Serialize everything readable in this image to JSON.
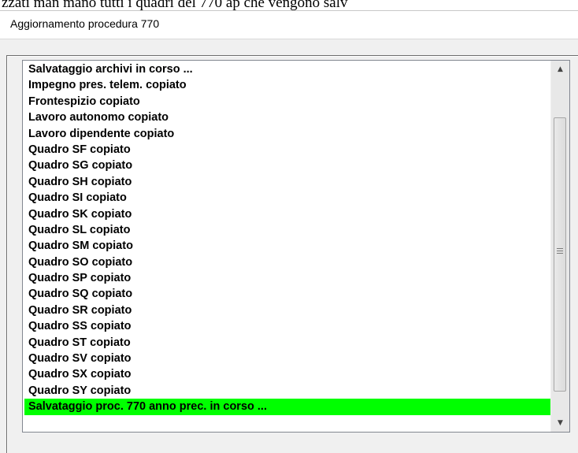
{
  "background_text": "zzati man mano tutti i quadri del 770 ap che vengono salv",
  "window": {
    "title": "Aggiornamento procedura 770"
  },
  "list": {
    "items": [
      "Salvataggio archivi in corso ...",
      "Impegno pres. telem. copiato",
      "Frontespizio copiato",
      "Lavoro autonomo copiato",
      "Lavoro dipendente copiato",
      "Quadro SF copiato",
      "Quadro SG copiato",
      "Quadro SH copiato",
      "Quadro SI copiato",
      "Quadro SK copiato",
      "Quadro SL copiato",
      "Quadro SM copiato",
      "Quadro SO copiato",
      "Quadro SP copiato",
      "Quadro SQ copiato",
      "Quadro SR copiato",
      "Quadro SS copiato",
      "Quadro ST copiato",
      "Quadro SV copiato",
      "Quadro SX copiato",
      "Quadro SY copiato",
      "Salvataggio proc. 770 anno prec. in corso ..."
    ],
    "selected_index": 21,
    "selected_color": "#00ff00"
  },
  "scrollbar": {
    "up_icon": "arrow-up-icon",
    "down_icon": "arrow-down-icon",
    "grip_icon": "grip-icon"
  }
}
